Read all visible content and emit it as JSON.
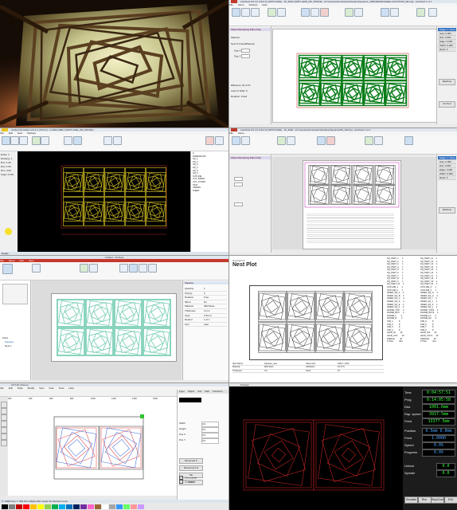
{
  "photo": {
    "caption": ""
  },
  "nesting_app_1": {
    "title": "AutoNest FS 4.0 (V6.0.6) (SPRT-HWE) - ID_3000 (SPRT-HWE_MS_PROFE) - [C:\\Users\\Administrator\\Desktop\\Squares_1BRVDEWR\\SHEELCOUNT\\MS_NE.hip] - AutoNest 1 of 1",
    "menu": [
      "File",
      "Home",
      "Settings",
      "Help"
    ],
    "section_header": "Sheet Remaining Parts Only",
    "fields": [
      {
        "label": "Material",
        "value": ""
      },
      {
        "label": "Nest % (Used/Placed)",
        "value": ""
      },
      {
        "label": "Gap X",
        "value": ""
      },
      {
        "label": "Gap Y",
        "value": ""
      },
      {
        "label": "Efficiency",
        "value": "81.17%"
      },
      {
        "label": "Area % (F/E)",
        "value": "5"
      },
      {
        "label": "Rotation",
        "value": "Fixed"
      }
    ],
    "right_items": [
      "Stage 1 / None",
      "Gap: 0.000",
      "Dist: 0.000",
      "Edge: 0.000",
      "Width: 0.000",
      "Rank: 3"
    ],
    "machine_button": "Machine",
    "bottom_item": "No Tool"
  },
  "cad_app": {
    "title": "untitled Simulation FS 6.4 (V6.0.6) - 0-3000-ABZU (SPRT-HWE_MS_PROFE)",
    "menu": [
      "File",
      "Edit",
      "View",
      "Settings"
    ],
    "layer_list": [
      "0",
      "DIMENSIONS",
      "SQ_1",
      "SQ_2",
      "SQ_3",
      "SQ_4",
      "SQ_5",
      "SQ_6",
      "OUTLINE",
      "CUT_INNER",
      "CUT_OUTER",
      "TEXT",
      "HIDDEN",
      "SHEET"
    ],
    "left_values": [
      "Entity: 1",
      "Drawing: 1",
      "Dim: 1.00",
      "Dim: 1.00",
      "Dim: 4.00",
      "Snap: 0.001"
    ],
    "status": "Ready"
  },
  "nesting_app_2": {
    "title": "AutoNest FS 4.0 (V6.0.6) (SPRT-HWE) - ID_3000 - [C:\\Users\\Administrator\\Desktop\\Squares\\MS_NE.hip] - AutoNest 1 of 1",
    "section_header": "Sheet Remaining Parts Only",
    "right_items": [
      "Stage 1 / None",
      "Gap: 0.000",
      "Dist: 0.000",
      "Edge: 0.000",
      "Width: 0.000",
      "Rank: 3"
    ],
    "machine_button": "Machine"
  },
  "office_app": {
    "title": "Untitled - ProNest",
    "menu": [
      "File",
      "Home",
      "Part",
      "View"
    ],
    "panel_title": "Squares",
    "properties": [
      {
        "k": "Quantity",
        "v": "1"
      },
      {
        "k": "Priority",
        "v": "5"
      },
      {
        "k": "Rotation",
        "v": "Free"
      },
      {
        "k": "Mirror",
        "v": "No"
      },
      {
        "k": "Material",
        "v": "Mild Steel"
      },
      {
        "k": "Thickness",
        "v": "3 mm"
      },
      {
        "k": "Area",
        "v": "0.33 m²"
      },
      {
        "k": "Nested",
        "v": "1 of 1"
      },
      {
        "k": "Kerf",
        "v": "Auto"
      }
    ],
    "left_items": [
      "Parts",
      "Squares",
      "Nest 1"
    ]
  },
  "nest_report": {
    "brand": "NestingSoft",
    "title": "Nest Plot",
    "footer_rows": [
      [
        "Nest Name:",
        "Squares_nest",
        "Sheet size:",
        "2440 x 1220"
      ],
      [
        "Material:",
        "Mild Steel",
        "Utilization:",
        "81.17%"
      ],
      [
        "Thickness:",
        "3.0",
        "Parts:",
        "10"
      ]
    ],
    "part_list_left": "SQ_PART_1      1\nSQ_PART_2      1\nSQ_PART_3      1\nSQ_PART_4      1\nSQ_PART_5      1\nSQ_PART_6      1\nSQ_PART_7      1\nSQ_PART_8      1\nSQ_PART_9      1\nSQ_PART_10     1\nOUTLINE_1      1\nOUTLINE_2      1\nINNER_SQ_A     4\nINNER_SQ_B     4\nINNER_SQ_C     4\nINNER_SQ_D     4\nINNER_SQ_E     4\nINNER_SQ_F     4\nFRAME_TOP      2\nFRAME_BOT      2\nFRAME_L        2\nFRAME_R        2\nTAB_1          8\nTAB_2          8\nTAB_3          8\nTAB_4          8\nLEAD_IN        40\nLEAD_OUT       40\nPIERCE         40\nTOTAL          204",
    "part_list_right": "SQ_PART_11     1\nSQ_PART_12     1\nSQ_PART_13     1\nSQ_PART_14     1\nSQ_PART_15     1\nSQ_PART_16     1\nSQ_PART_17     1\nSQ_PART_18     1\nSQ_PART_19     1\nSQ_PART_20     1\nOUTLINE_3      1\nOUTLINE_4      1\nINNER_SQ_G     4\nINNER_SQ_H     4\nINNER_SQ_I     4\nINNER_SQ_J     4\nINNER_SQ_K     4\nINNER_SQ_L     4\nFRAME_TOP2     2\nFRAME_BOT2     2\nFRAME_L2       2\nFRAME_R2       2\nTAB_5          8\nTAB_6          8\nTAB_7          8\nTAB_8          8\nLEAD_IN2       40\nLEAD_OUT2      40\nPIERCE2        40\nTOTAL          204"
  },
  "cam_app": {
    "title": "CUT-DL (Demo)",
    "menu": [
      "File",
      "Edit",
      "Draw",
      "Modify",
      "Nest",
      "View",
      "Tools",
      "Help"
    ],
    "ruler": [
      "200",
      "400",
      "600",
      "800",
      "1000",
      "1200",
      "1400",
      "1600"
    ],
    "tabs": [
      "Layer",
      "Object",
      "Tool",
      "Path",
      "Transform"
    ],
    "props": [
      {
        "k": "Width",
        "v": "0.0"
      },
      {
        "k": "Height",
        "v": "0.0"
      },
      {
        "k": "Pos X",
        "v": "0.0"
      },
      {
        "k": "Pos Y",
        "v": "0.0"
      }
    ],
    "buttons": [
      "Ramp/Lead In",
      "Ramp/Lead Out",
      "Tab",
      "Offset"
    ],
    "checks": [
      "Cut outside",
      "Cut inside"
    ],
    "status": "X: 1290.5mm Y: 640.3mm   Right click mouse for shortcut menu   ",
    "palette": [
      "#000000",
      "#7f7f7f",
      "#c00000",
      "#ff0000",
      "#ffc000",
      "#ffff00",
      "#92d050",
      "#00b050",
      "#00b0f0",
      "#0070c0",
      "#002060",
      "#7030a0",
      "#ff66cc",
      "#996633",
      "#ffffff",
      "#a6a6a6",
      "#3399ff",
      "#66ff66",
      "#ff9999",
      "#cc99ff"
    ]
  },
  "controller": {
    "title": "Preview",
    "readouts": [
      {
        "label": "Time",
        "value": "0:04:57:51"
      },
      {
        "label": "Prog.",
        "value": "0:14:05:58"
      },
      {
        "label": "Dist.",
        "value": "1001.6mm"
      },
      {
        "label": "Rap. speed",
        "value": "3917.5mm"
      },
      {
        "label": "Feed",
        "value": "13377.5mm"
      }
    ],
    "mid_readouts": [
      {
        "label": "Position",
        "value": "6.5mm 0.0mm"
      },
      {
        "label": "Feed",
        "value": "1.0000"
      },
      {
        "label": "Speed",
        "value": "0.0%"
      },
      {
        "label": "Progress",
        "value": "0.0%"
      }
    ],
    "lower_readouts": [
      {
        "label": "Unlock",
        "value": "0.0"
      },
      {
        "label": "Spindle",
        "value": "0.0"
      }
    ],
    "buttons": [
      "Simulate",
      "Run",
      "Stop/Continue",
      "Exit"
    ]
  }
}
